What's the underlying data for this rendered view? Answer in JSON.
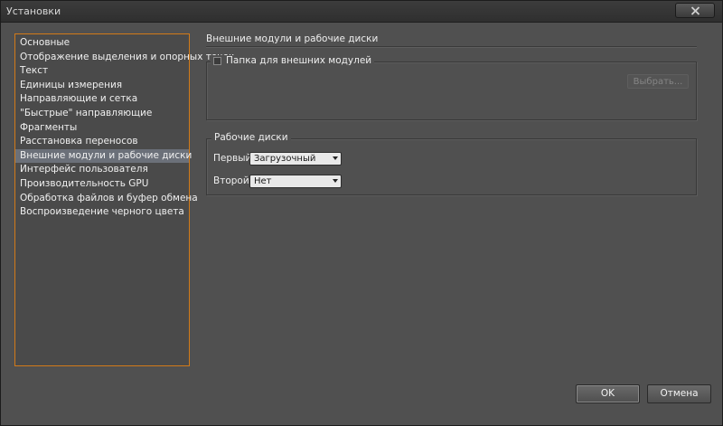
{
  "window": {
    "title": "Установки",
    "close_icon": "close-icon"
  },
  "sidebar": {
    "items": [
      {
        "label": "Основные",
        "selected": false
      },
      {
        "label": "Отображение выделения и опорных точек",
        "selected": false
      },
      {
        "label": "Текст",
        "selected": false
      },
      {
        "label": "Единицы измерения",
        "selected": false
      },
      {
        "label": "Направляющие и сетка",
        "selected": false
      },
      {
        "label": "\"Быстрые\" направляющие",
        "selected": false
      },
      {
        "label": "Фрагменты",
        "selected": false
      },
      {
        "label": "Расстановка переносов",
        "selected": false
      },
      {
        "label": "Внешние модули и рабочие диски",
        "selected": true
      },
      {
        "label": "Интерфейс пользователя",
        "selected": false
      },
      {
        "label": "Производительность GPU",
        "selected": false
      },
      {
        "label": "Обработка файлов и буфер обмена",
        "selected": false
      },
      {
        "label": "Воспроизведение черного цвета",
        "selected": false
      }
    ]
  },
  "main": {
    "section_title": "Внешние модули и рабочие диски",
    "plugins": {
      "checkbox_label": "Папка для внешних модулей",
      "checked": false,
      "choose_button": "Выбрать..."
    },
    "scratch_disks": {
      "legend": "Рабочие диски",
      "first_label": "Первый:",
      "first_value": "Загрузочный",
      "second_label": "Второй:",
      "second_value": "Нет"
    }
  },
  "footer": {
    "ok_label": "OK",
    "cancel_label": "Отмена"
  },
  "colors": {
    "accent_border": "#d27a18",
    "selected_row": "#6b7079",
    "panel_bg": "#505050"
  }
}
